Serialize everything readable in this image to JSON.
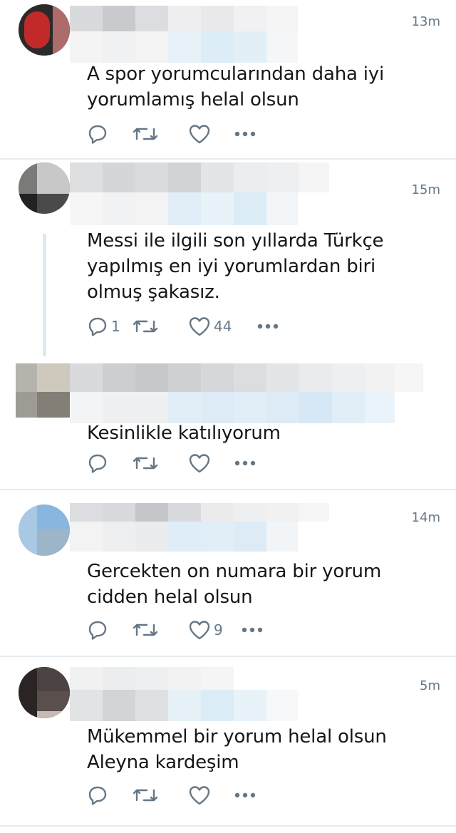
{
  "replies": [
    {
      "time": "13m",
      "text_lines": [
        "A spor yorumcularından daha iyi",
        "yorumlamış helal olsun"
      ],
      "reply_count": "",
      "like_count": ""
    },
    {
      "time": "15m",
      "text_lines": [
        "Messi ile ilgili son yıllarda Türkçe",
        "yapılmış en iyi yorumlardan biri",
        "olmuş şakasız."
      ],
      "reply_count": "1",
      "like_count": "44"
    },
    {
      "time": "",
      "text_lines": [
        "Kesinlikle katılıyorum"
      ],
      "reply_count": "",
      "like_count": ""
    },
    {
      "time": "14m",
      "text_lines": [
        "Gercekten on numara bir yorum",
        "cidden helal olsun"
      ],
      "reply_count": "",
      "like_count": "9"
    },
    {
      "time": "5m",
      "text_lines": [
        "Mükemmel bir yorum helal olsun",
        "Aleyna kardeşim"
      ],
      "reply_count": "",
      "like_count": ""
    }
  ],
  "icons": {
    "reply": "reply-icon",
    "retweet": "retweet-icon",
    "like": "heart-icon",
    "more": "more-icon"
  },
  "colors": {
    "text": "#14171a",
    "muted": "#657786",
    "divider": "#e6ecf0",
    "thread_line": "#e1e8ed"
  }
}
